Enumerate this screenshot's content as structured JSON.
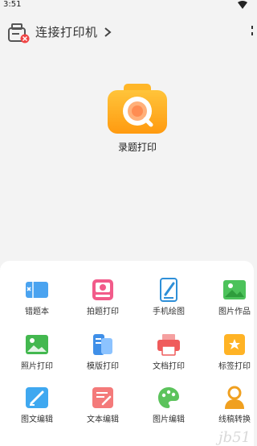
{
  "status": {
    "time": "3:51"
  },
  "header": {
    "connect_label": "连接打印机"
  },
  "capture": {
    "label": "录题打印"
  },
  "tools": [
    {
      "label": "错题本"
    },
    {
      "label": "拍题打印"
    },
    {
      "label": "手机绘图"
    },
    {
      "label": "图片作品"
    },
    {
      "label": "照片打印"
    },
    {
      "label": "模版打印"
    },
    {
      "label": "文档打印"
    },
    {
      "label": "标签打印"
    },
    {
      "label": "图文编辑"
    },
    {
      "label": "文本编辑"
    },
    {
      "label": "图片编辑"
    },
    {
      "label": "线稿转换"
    }
  ],
  "watermark": "jb51"
}
